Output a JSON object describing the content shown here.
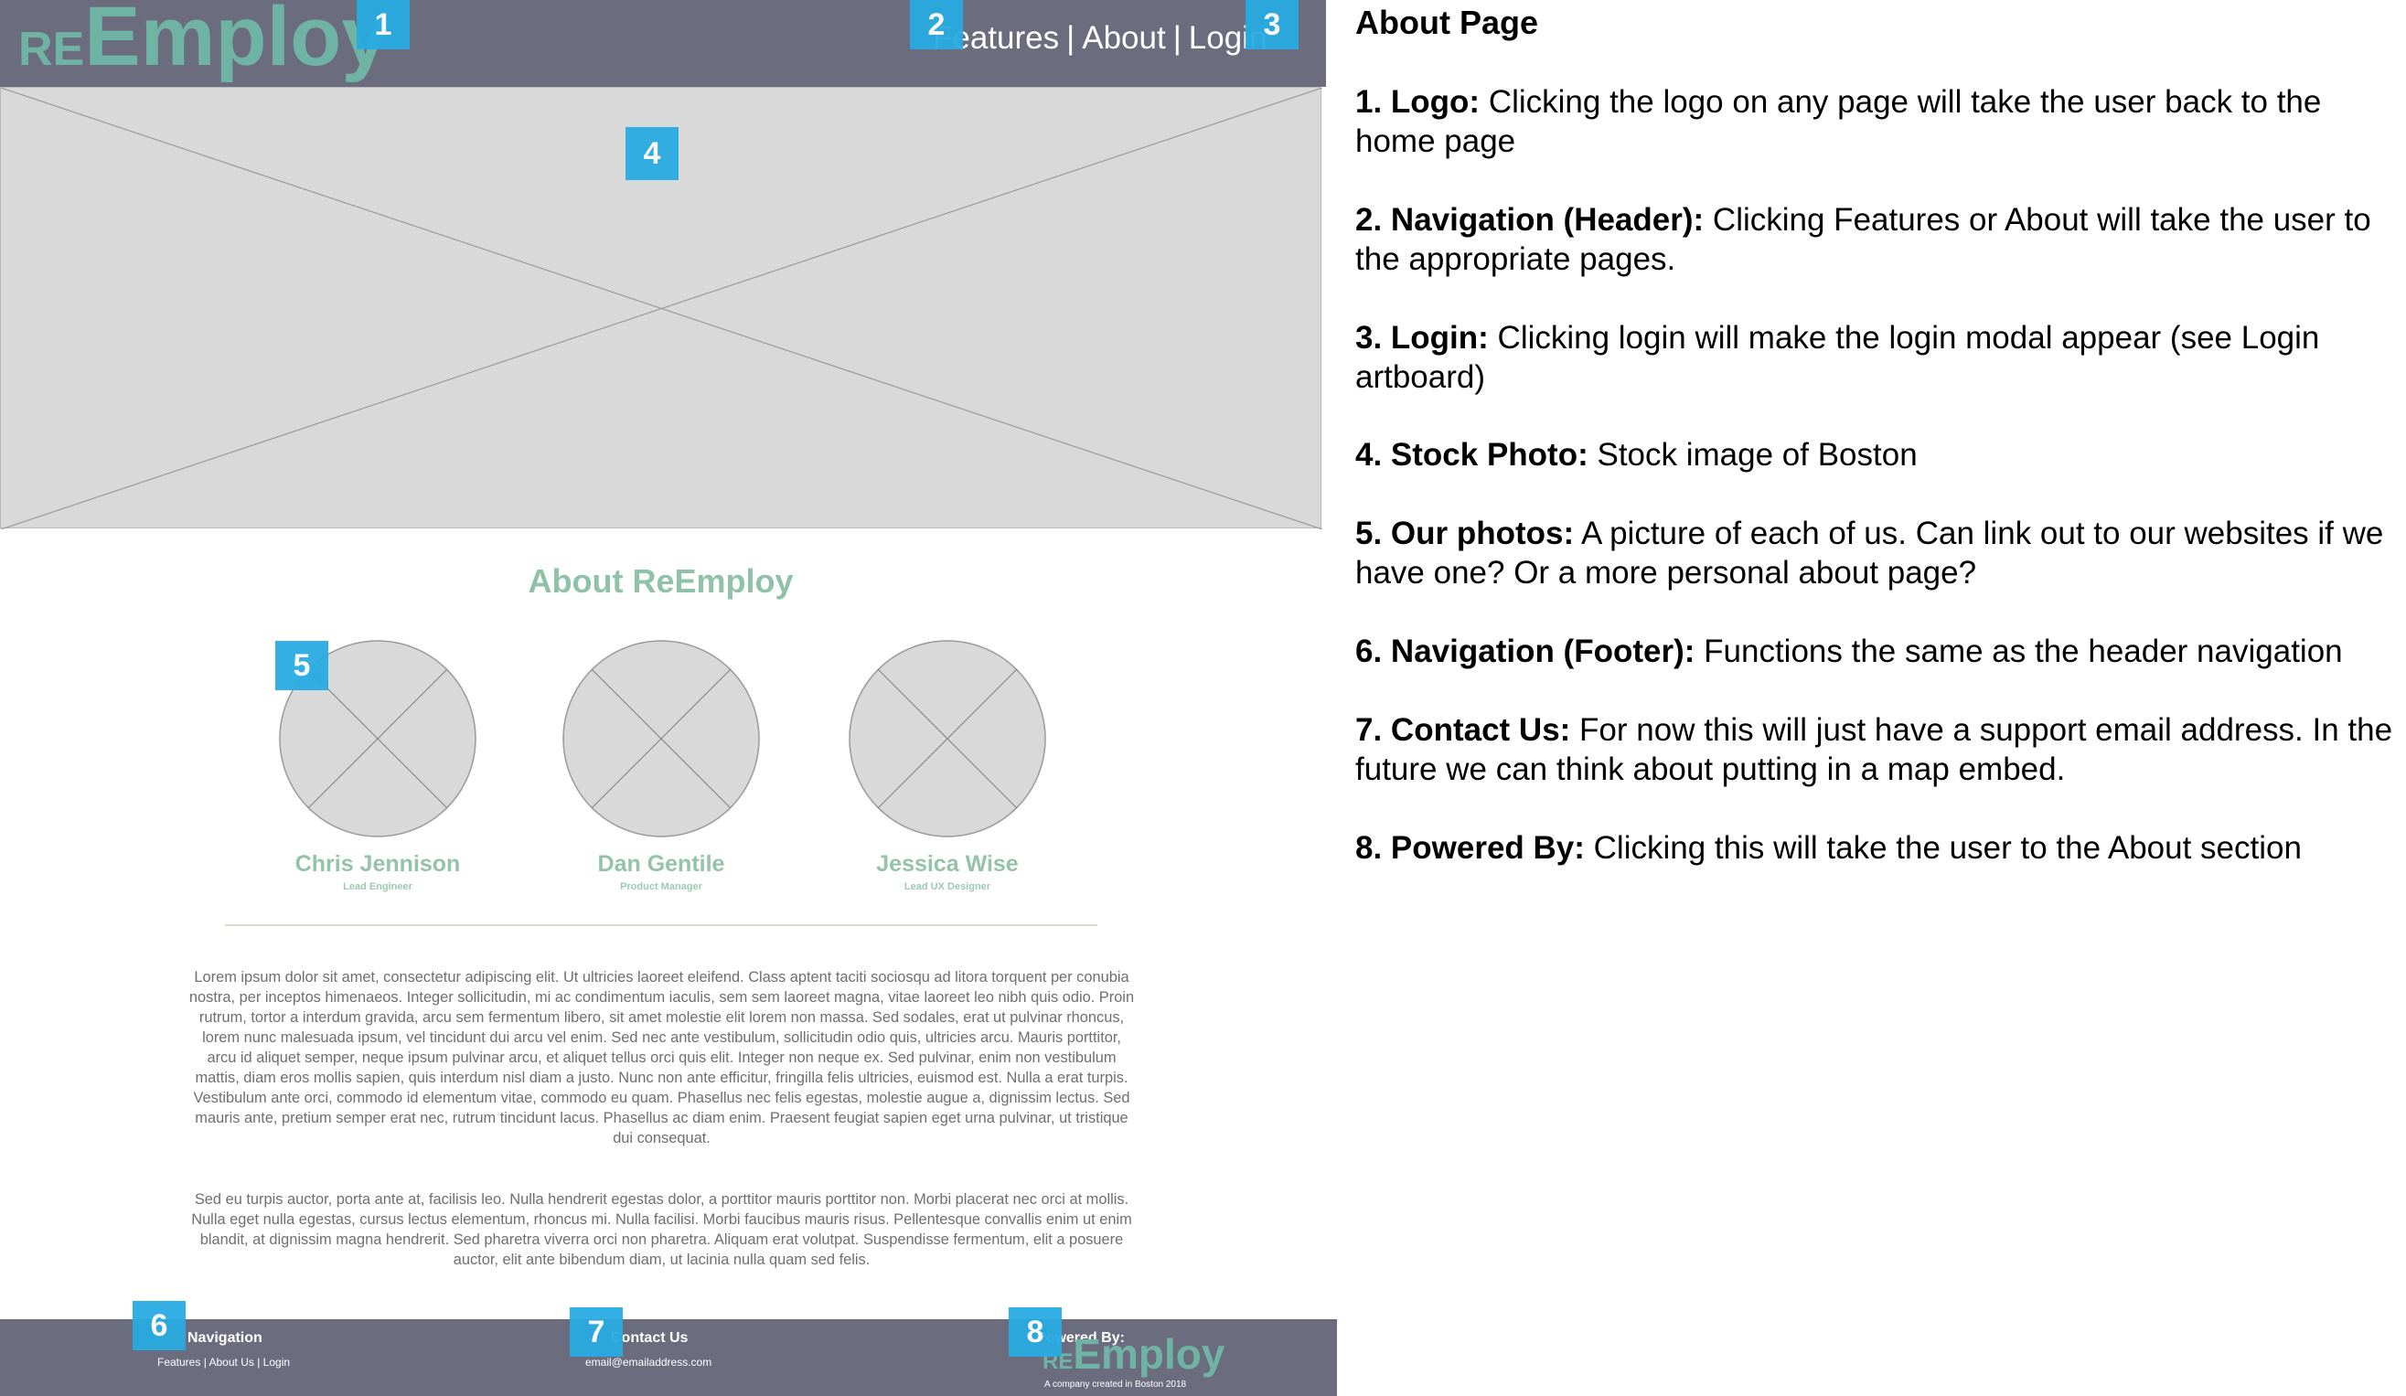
{
  "header": {
    "logo": {
      "prefix": "RE",
      "main": "Employ"
    },
    "nav": {
      "features": "Features",
      "about": "About",
      "login": "Login",
      "separator": "|"
    }
  },
  "about": {
    "title": "About ReEmploy",
    "team": [
      {
        "name": "Chris Jennison",
        "role": "Lead Engineer"
      },
      {
        "name": "Dan Gentile",
        "role": "Product Manager"
      },
      {
        "name": "Jessica Wise",
        "role": "Lead UX Designer"
      }
    ],
    "paragraphs": [
      "Lorem ipsum dolor sit amet, consectetur adipiscing elit. Ut ultricies laoreet eleifend. Class aptent taciti sociosqu ad litora torquent per conubia nostra, per inceptos himenaeos. Integer sollicitudin, mi ac condimentum iaculis, sem sem laoreet magna, vitae laoreet leo nibh quis odio. Proin rutrum, tortor a interdum gravida, arcu sem fermentum libero, sit amet molestie elit lorem non massa. Sed sodales, erat ut pulvinar rhoncus, lorem nunc malesuada ipsum, vel tincidunt dui arcu vel enim. Sed nec ante vestibulum, sollicitudin odio quis, ultricies arcu. Mauris porttitor, arcu id aliquet semper, neque ipsum pulvinar arcu, et aliquet tellus orci quis elit. Integer non neque ex. Sed pulvinar, enim non vestibulum mattis, diam eros mollis sapien, quis interdum nisl diam a justo. Nunc non ante efficitur, fringilla felis ultricies, euismod est. Nulla a erat turpis. Vestibulum ante orci, commodo id elementum vitae, commodo eu quam. Phasellus nec felis egestas, molestie augue a, dignissim lectus. Sed mauris ante, pretium semper erat nec, rutrum tincidunt lacus. Phasellus ac diam enim. Praesent feugiat sapien eget urna pulvinar, ut tristique dui consequat.",
      "Sed eu turpis auctor, porta ante at, facilisis leo. Nulla hendrerit egestas dolor, a porttitor mauris porttitor non. Morbi placerat nec orci at mollis. Nulla eget nulla egestas, cursus lectus elementum, rhoncus mi. Nulla facilisi. Morbi faucibus mauris risus. Pellentesque convallis enim ut enim blandit, at dignissim magna hendrerit. Sed pharetra viverra orci non pharetra. Aliquam erat volutpat. Suspendisse fermentum, elit a posuere auctor, elit ante bibendum diam, ut lacinia nulla quam sed felis."
    ]
  },
  "footer": {
    "navigation": {
      "heading": "Navigation",
      "features": "Features",
      "about": "About Us",
      "login": "Login",
      "separator": "|"
    },
    "contact": {
      "heading": "Contact Us",
      "email": "email@emailaddress.com"
    },
    "powered": {
      "heading": "Powered By:",
      "logo_prefix": "RE",
      "logo_main": "Employ",
      "company": "A company created in Boston 2018"
    }
  },
  "markers": [
    "1",
    "2",
    "3",
    "4",
    "5",
    "6",
    "7",
    "8"
  ],
  "notes": {
    "title": "About Page",
    "items": [
      {
        "label": "1. Logo:",
        "text": " Clicking the logo on any page will take the user back to the home page"
      },
      {
        "label": "2. Navigation (Header):",
        "text": " Clicking Features or About will take the user to the appropriate pages."
      },
      {
        "label": "3. Login:",
        "text": " Clicking login will make the login modal appear (see Login artboard)"
      },
      {
        "label": "4. Stock Photo:",
        "text": " Stock image of Boston"
      },
      {
        "label": "5. Our photos:",
        "text": " A picture of each of us. Can link out to our websites if we have one? Or a more personal about page?"
      },
      {
        "label": "6. Navigation (Footer):",
        "text": " Functions the same as the header navigation"
      },
      {
        "label": "7. Contact Us:",
        "text": " For now this will just have a support email address. In the future we can think about putting in a map embed."
      },
      {
        "label": "8. Powered By:",
        "text": " Clicking this will take the user to the About section"
      }
    ]
  },
  "colors": {
    "header_bg": "#6b6d7f",
    "accent_green": "#8fc2a8",
    "marker_blue": "#29abe2",
    "placeholder_gray": "#d9d9d9"
  }
}
